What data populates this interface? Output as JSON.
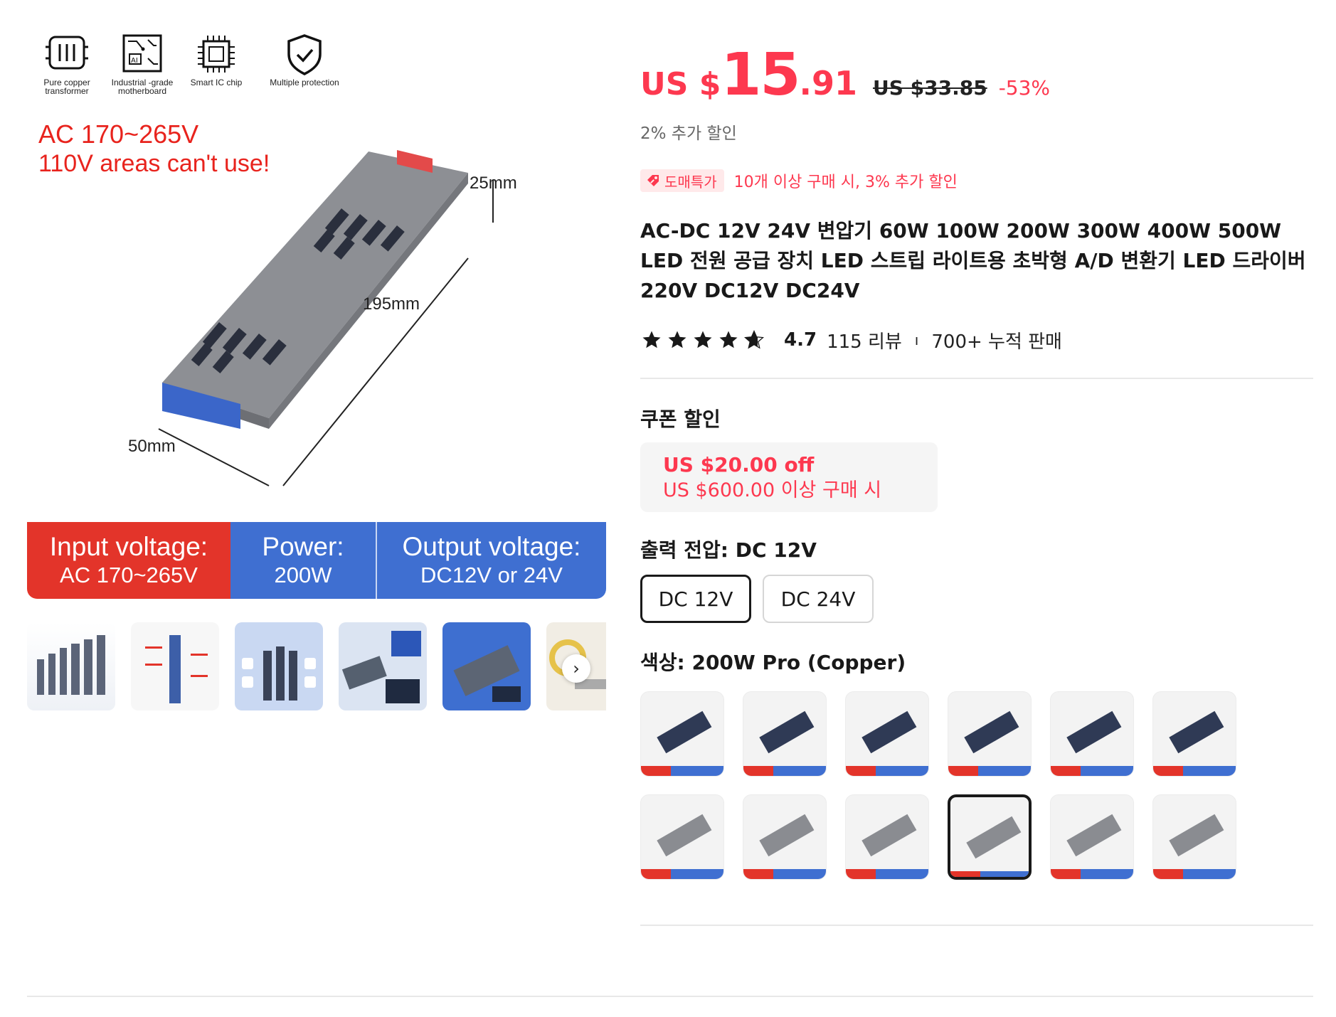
{
  "gallery": {
    "features": [
      {
        "label": "Pure copper transformer",
        "icon": "copper-coil-icon"
      },
      {
        "label": "Industrial -grade motherboard",
        "icon": "circuit-board-icon"
      },
      {
        "label": "Smart IC chip",
        "icon": "chip-icon"
      },
      {
        "label": "Multiple protection",
        "icon": "shield-check-icon"
      }
    ],
    "warning_line1": "AC 170~265V",
    "warning_line2": "110V areas can't use!",
    "dim_height": "25mm",
    "dim_length": "195mm",
    "dim_width": "50mm",
    "spec_input_label": "Input voltage:",
    "spec_input_value": "AC 170~265V",
    "spec_power_label": "Power:",
    "spec_power_value": "200W",
    "spec_output_label": "Output voltage:",
    "spec_output_value": "DC12V or 24V",
    "next_arrow": "›"
  },
  "product": {
    "price_currency": "US $",
    "price_integer": "15",
    "price_decimal": ".91",
    "original_price": "US $33.85",
    "discount_percent": "-53%",
    "extra_discount": "2% 추가 할인",
    "wholesale_badge": "도매특가",
    "wholesale_text": "10개 이상 구매 시, 3% 추가 할인",
    "title": "AC-DC 12V 24V 변압기 60W 100W 200W 300W 400W 500W LED 전원 공급 장치 LED 스트립 라이트용 초박형 A/D 변환기 LED 드라이버 220V DC12V DC24V",
    "rating_score": "4.7",
    "rating_stars": 4.7,
    "reviews": "115 리뷰",
    "rating_separator": "ı",
    "sold": "700+ 누적 판매"
  },
  "coupon": {
    "section_title": "쿠폰 할인",
    "amount": "US $20.00 off",
    "condition": "US $600.00 이상 구매 시"
  },
  "sku": {
    "voltage_label": "출력 전압: ",
    "voltage_selected": "DC 12V",
    "voltage_options": [
      "DC 12V",
      "DC 24V"
    ],
    "color_label": "색상: ",
    "color_selected": "200W Pro (Copper)"
  },
  "colors": {
    "accent_red": "#fd384f",
    "banner_red": "#e3342a",
    "banner_blue": "#3f6fd1",
    "text_dark": "#191919"
  }
}
